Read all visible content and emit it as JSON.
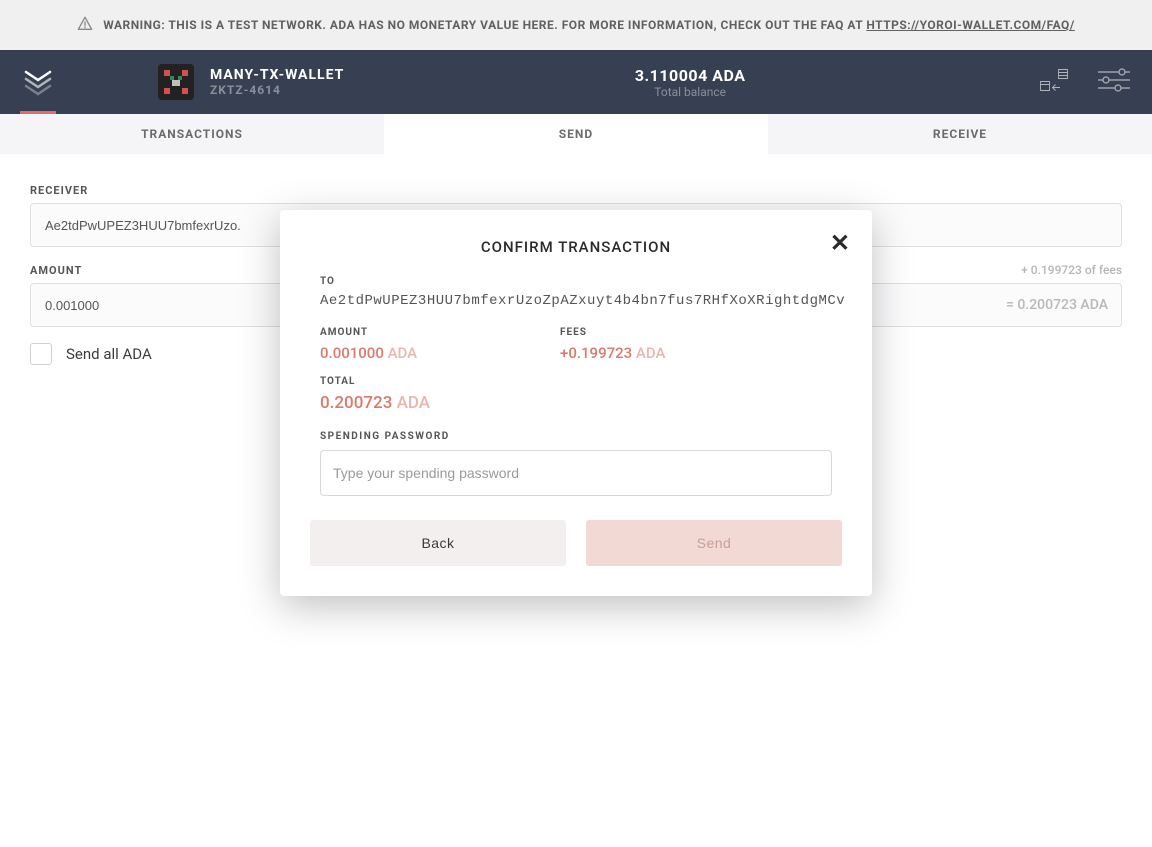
{
  "warning": {
    "text_prefix": "WARNING: THIS IS A TEST NETWORK. ADA HAS NO MONETARY VALUE HERE. FOR MORE INFORMATION, CHECK OUT THE FAQ AT ",
    "link": "HTTPS://YOROI-WALLET.COM/FAQ/"
  },
  "header": {
    "wallet_name": "MANY-TX-WALLET",
    "wallet_id": "ZKTZ-4614",
    "balance": "3.110004 ADA",
    "balance_label": "Total balance"
  },
  "tabs": {
    "transactions": "TRANSACTIONS",
    "send": "SEND",
    "receive": "RECEIVE"
  },
  "form": {
    "receiver_label": "RECEIVER",
    "receiver_value": "Ae2tdPwUPEZ3HUU7bmfexrUzo.",
    "amount_label": "AMOUNT",
    "fee_note": "+ 0.199723 of fees",
    "amount_value": "0.001000",
    "amount_total": "= 0.200723 ADA",
    "send_all_label": "Send all ADA"
  },
  "modal": {
    "title": "CONFIRM TRANSACTION",
    "to_label": "TO",
    "to_value": "Ae2tdPwUPEZ3HUU7bmfexrUzoZpAZxuyt4b4bn7fus7RHfXoXRightdgMCv",
    "amount_label": "AMOUNT",
    "amount_value": "0.001000",
    "amount_unit": "ADA",
    "fees_label": "FEES",
    "fees_value": "+0.199723",
    "fees_unit": "ADA",
    "total_label": "TOTAL",
    "total_value": "0.200723",
    "total_unit": "ADA",
    "pw_label": "SPENDING PASSWORD",
    "pw_placeholder": "Type your spending password",
    "back_label": "Back",
    "send_label": "Send"
  }
}
